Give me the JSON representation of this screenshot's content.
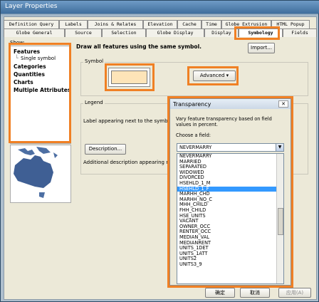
{
  "window": {
    "title": "Layer Properties"
  },
  "tabs_row1": [
    "Definition Query",
    "Labels",
    "Joins & Relates",
    "Elevation",
    "Cache",
    "Time",
    "Globe Extrusion",
    "HTML Popup"
  ],
  "tabs_row2": [
    "Globe General",
    "Source",
    "Selection",
    "Globe Display",
    "Display",
    "Symbology",
    "Fields"
  ],
  "active_tab": "Symbology",
  "show": {
    "label": "Show:",
    "items": [
      "Features",
      "Single symbol",
      "Categories",
      "Quantities",
      "Charts",
      "Multiple Attributes"
    ]
  },
  "symbology": {
    "heading": "Draw all features using the same symbol.",
    "import_label": "Import...",
    "symbol_group": "Symbol",
    "symbol_fill": "#fde4b8",
    "advanced_label": "Advanced",
    "legend_group": "Legend",
    "legend_text": "Label appearing next to the symbol i",
    "description_label": "Description...",
    "additional_text": "Additional description appearing nex"
  },
  "transparency": {
    "title": "Transparency",
    "description": "Vary feature transparency based on field values in percent.",
    "choose_label": "Choose a field:",
    "selected_value": "NEVERMARRY",
    "fields": [
      "NEVERMARRY",
      "MARRIED",
      "SEPARATED",
      "WIDOWED",
      "DIVORCED",
      "HSEHLD_1_M",
      "HSEHLD_1_F",
      "MARHH_CHD",
      "MARHH_NO_C",
      "MHH_CHILD",
      "FHH_CHILD",
      "HSE_UNITS",
      "VACANT",
      "OWNER_OCC",
      "RENTER_OCC",
      "MEDIAN_VAL",
      "MEDIANRENT",
      "UNITS_1DET",
      "UNITS_1ATT",
      "UNITS2",
      "UNITS3_9"
    ],
    "highlighted_field": "HSEHLD_1_F"
  },
  "footer": {
    "ok_label": "确定",
    "cancel_label": "取消",
    "apply_label": "应用(A)"
  },
  "colors": {
    "highlight": "#f08024",
    "selection": "#3399ff"
  }
}
